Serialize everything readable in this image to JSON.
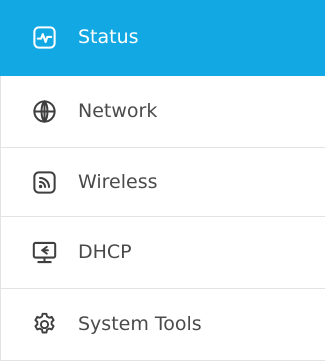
{
  "colors": {
    "active_background": "#12a8e3",
    "active_text": "#ffffff",
    "text": "#4a4a4a",
    "icon": "#3f3f3f",
    "divider": "#e3e3e3"
  },
  "menu": {
    "items": [
      {
        "label": "Status",
        "icon": "status-icon",
        "active": true
      },
      {
        "label": "Network",
        "icon": "globe-icon",
        "active": false
      },
      {
        "label": "Wireless",
        "icon": "wireless-icon",
        "active": false
      },
      {
        "label": "DHCP",
        "icon": "dhcp-icon",
        "active": false
      },
      {
        "label": "System Tools",
        "icon": "gear-icon",
        "active": false
      }
    ]
  }
}
